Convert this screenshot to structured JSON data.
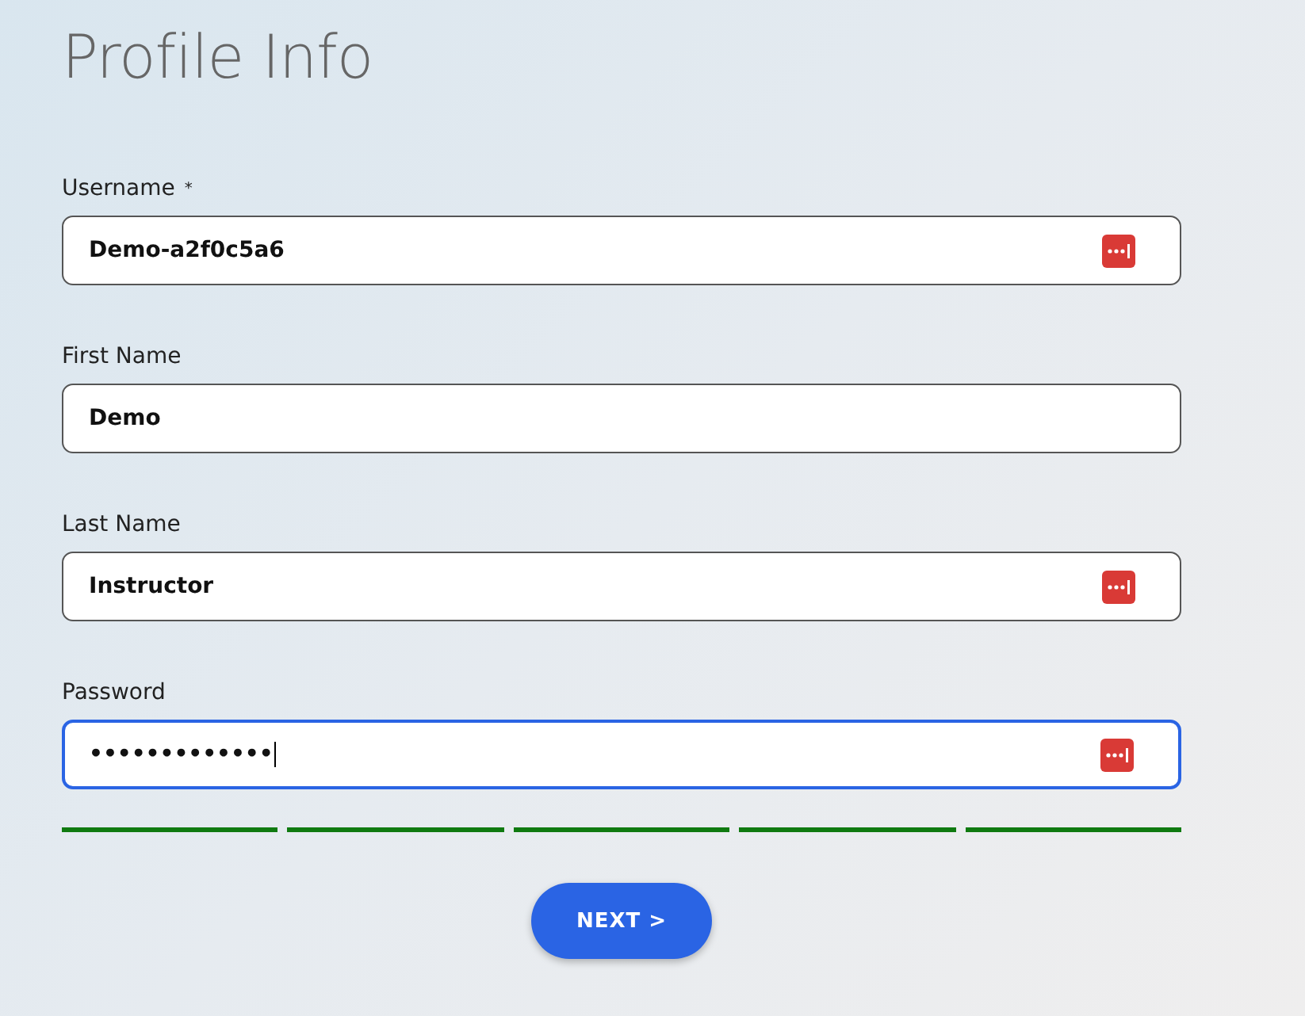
{
  "title": "Profile Info",
  "fields": [
    {
      "label": "Username",
      "required_mark": "*",
      "value": "Demo-a2f0c5a6",
      "focused": false,
      "manager_icon": true
    },
    {
      "label": "First Name",
      "value": "Demo",
      "focused": false,
      "manager_icon": false
    },
    {
      "label": "Last Name",
      "value": "Instructor",
      "focused": false,
      "manager_icon": true
    },
    {
      "label": "Password",
      "value": "•••••••••••••",
      "focused": true,
      "manager_icon": true
    }
  ],
  "strength_meter": [
    {
      "on": true
    },
    {
      "on": true
    },
    {
      "on": true
    },
    {
      "on": true
    },
    {
      "on": true
    }
  ],
  "next_button": "NEXT >"
}
